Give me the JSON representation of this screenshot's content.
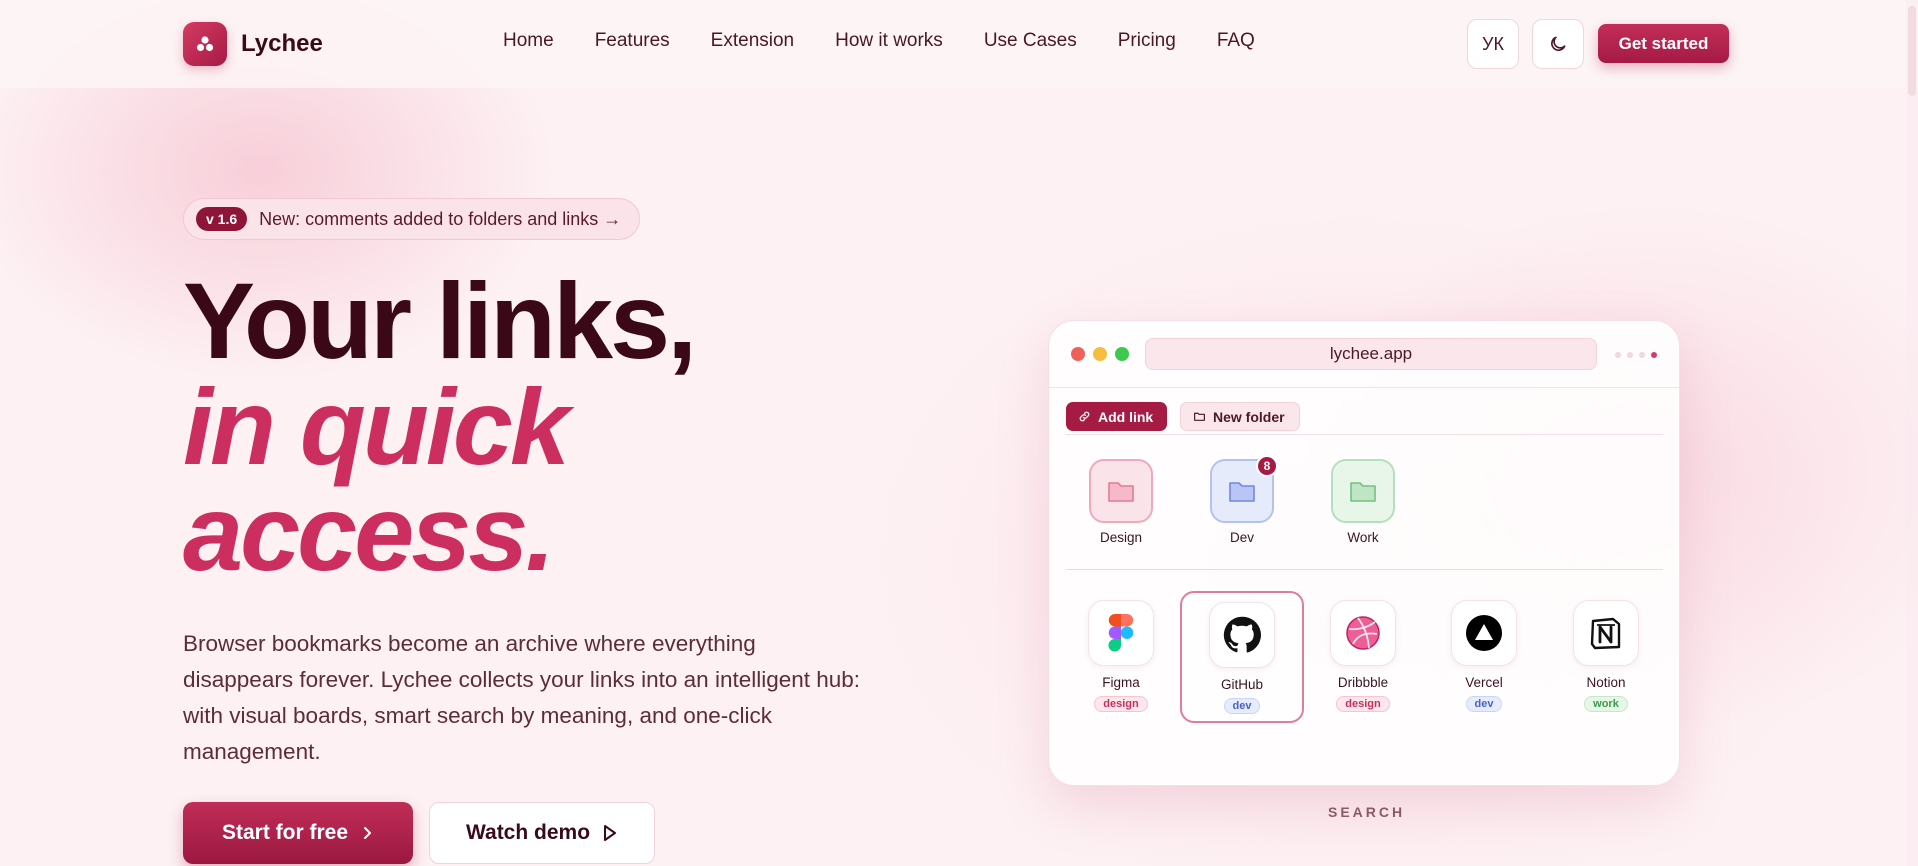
{
  "brand": {
    "name": "Lychee"
  },
  "nav": {
    "items": [
      "Home",
      "Features",
      "Extension",
      "How it works",
      "Use Cases",
      "Pricing",
      "FAQ"
    ],
    "lang": "УК",
    "cta": "Get started"
  },
  "hero": {
    "badge": "v 1.6",
    "announcement": "New: comments added to folders and links →",
    "title_line1": "Your links,",
    "title_line2": "in quick",
    "title_line3": "access.",
    "description": "Browser bookmarks become an archive where everything disappears forever. Lychee collects your links into an intelligent hub: with visual boards, smart search by meaning, and one-click management.",
    "start_button": "Start for free",
    "demo_button": "Watch demo"
  },
  "mock": {
    "url": "lychee.app",
    "add_link": "Add link",
    "new_folder": "New folder",
    "folders": [
      {
        "label": "Design",
        "color": "#e86b8c"
      },
      {
        "label": "Dev",
        "color": "#7089e0",
        "count": "8"
      },
      {
        "label": "Work",
        "color": "#72c27e"
      }
    ],
    "links": [
      {
        "label": "Figma",
        "tag": "design",
        "icon": "figma-icon"
      },
      {
        "label": "GitHub",
        "tag": "dev",
        "icon": "github-icon"
      },
      {
        "label": "Dribbble",
        "tag": "design",
        "icon": "dribbble-icon"
      },
      {
        "label": "Vercel",
        "tag": "dev",
        "icon": "vercel-icon"
      },
      {
        "label": "Notion",
        "tag": "work",
        "icon": "notion-icon"
      }
    ],
    "section_label": "SEARCH"
  },
  "colors": {
    "accent": "#a51b44",
    "accent_light": "#cc2f5f",
    "background": "#fdf1f3"
  }
}
